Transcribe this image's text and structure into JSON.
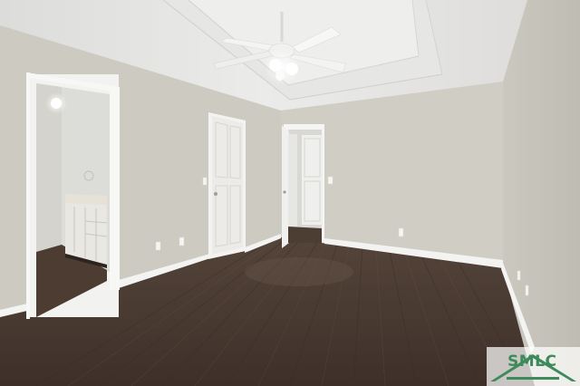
{
  "scene": {
    "description_tags": [
      "room-photo"
    ],
    "colors": {
      "wall": "#cfcdc3",
      "wall_right": "#c7c5bb",
      "ceiling": "#e4e4e2",
      "floor": "#4a3a30",
      "trim": "#f4f4f2",
      "door": "#ededeb",
      "bathroom_wall": "#dcdcd8",
      "vanity": "#e8e6e0"
    }
  },
  "watermark": {
    "text": "SMLC",
    "color": "#3f8a5a"
  }
}
